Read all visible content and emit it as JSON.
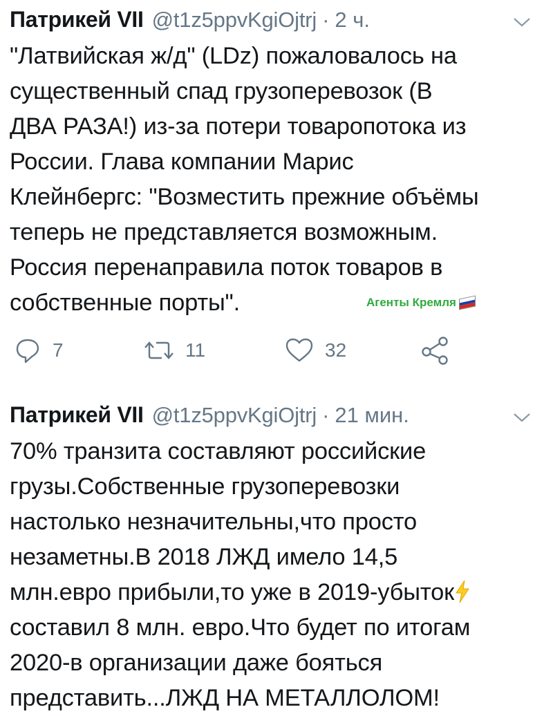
{
  "tweets": [
    {
      "author": "Патрикей VII",
      "handle": "@t1z5ppvKgiOjtrj",
      "separator": "·",
      "time": "2 ч.",
      "lines": [
        "\"Латвийская ж/д\" (LDz) пожаловалось на",
        "существенный спад грузоперевозок (В",
        "ДВА РАЗА!) из-за потери товаропотока из",
        "России. Глава компании Марис",
        "Клейнбергс: \"Возместить прежние объёмы",
        "теперь не представляется возможным.",
        "Россия перенаправила поток товаров в",
        "собственные порты\"."
      ],
      "sticker": "Агенты Кремля",
      "reply_count": "7",
      "retweet_count": "11",
      "like_count": "32"
    },
    {
      "author": "Патрикей VII",
      "handle": "@t1z5ppvKgiOjtrj",
      "separator": "·",
      "time": "21 мин.",
      "lines": [
        "70% транзита составляют российские",
        "грузы.Собственные грузоперевозки",
        "настолько незначительны,что просто",
        "незаметны.В 2018 ЛЖД имело 14,5",
        "млн.евро прибыли,то уже в 2019-убыток",
        "составил 8 млн. евро.Что будет по итогам",
        "2020-в организации даже бояться",
        "представить...ЛЖД НА МЕТАЛЛОЛОМ!"
      ],
      "emoji": "lightning-bolt-emoji"
    }
  ],
  "icons": {
    "caret": "chevron-down-icon",
    "reply": "reply-icon",
    "retweet": "retweet-icon",
    "like": "heart-icon",
    "share": "share-icon"
  },
  "colors": {
    "text": "#14171a",
    "secondary": "#657786",
    "sticker_green": "#2eaa3c",
    "bolt": "#ffcc22"
  }
}
